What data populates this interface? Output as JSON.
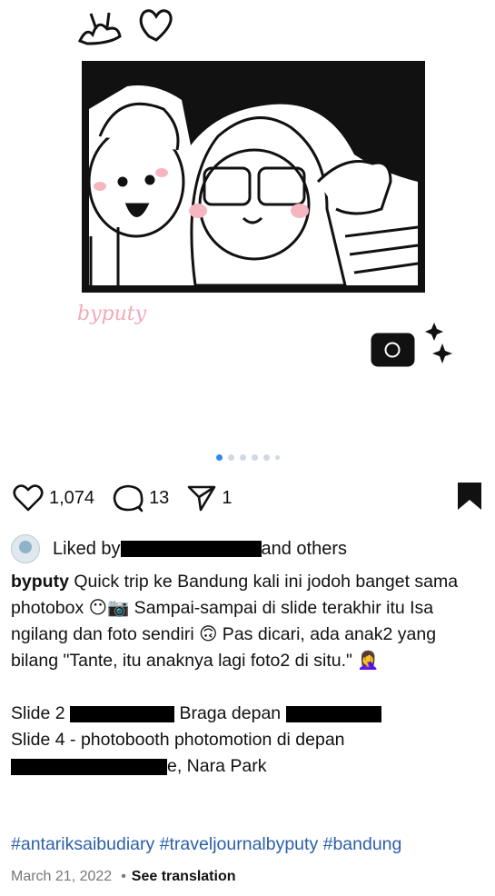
{
  "post": {
    "image_signature": "byputy",
    "carousel": {
      "count": 6,
      "active": 1
    }
  },
  "actions": {
    "likes": "1,074",
    "comments": "13",
    "shares": "1"
  },
  "liked_by": {
    "prefix": "Liked by ",
    "suffix": "and others"
  },
  "caption": {
    "username": "byputy",
    "line1": " Quick trip ke Bandung kali ini jodoh banget sama photobox 😶📷 Sampai-sampai di slide terakhir itu Isa ngilang dan foto sendiri 🙃 Pas dicari, ada anak2 yang bilang \"Tante, itu anaknya lagi foto2 di situ.\" 🤦‍♀️",
    "slide2_prefix": "Slide 2",
    "slide2_mid": " Braga depan ",
    "slide4": "Slide 4 - photobooth photomotion di depan",
    "slide4_suffix": "e, Nara Park"
  },
  "hashtags": "#antariksaibudiary #traveljournalbyputy #bandung",
  "footer": {
    "date": "March 21, 2022",
    "separator": "•",
    "see_translation": "See translation"
  }
}
